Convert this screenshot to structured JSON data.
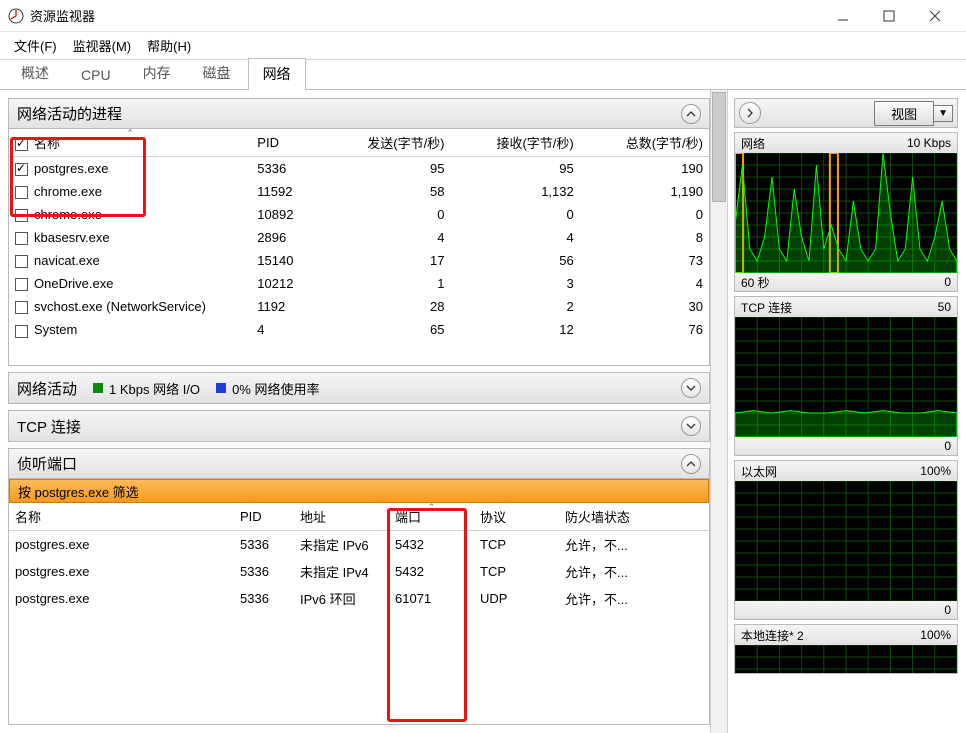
{
  "window": {
    "title": "资源监视器"
  },
  "menu": {
    "file": "文件(F)",
    "monitor": "监视器(M)",
    "help": "帮助(H)"
  },
  "tabs": {
    "t0": "概述",
    "t1": "CPU",
    "t2": "内存",
    "t3": "磁盘",
    "t4": "网络"
  },
  "panels": {
    "processes": {
      "title": "网络活动的进程",
      "cols": {
        "name": "名称",
        "pid": "PID",
        "send": "发送(字节/秒)",
        "recv": "接收(字节/秒)",
        "total": "总数(字节/秒)"
      },
      "rows": [
        {
          "checked": true,
          "name": "postgres.exe",
          "pid": "5336",
          "send": "95",
          "recv": "95",
          "total": "190"
        },
        {
          "checked": false,
          "name": "chrome.exe",
          "pid": "11592",
          "send": "58",
          "recv": "1,132",
          "total": "1,190"
        },
        {
          "checked": false,
          "name": "chrome.exe",
          "pid": "10892",
          "send": "0",
          "recv": "0",
          "total": "0"
        },
        {
          "checked": false,
          "name": "kbasesrv.exe",
          "pid": "2896",
          "send": "4",
          "recv": "4",
          "total": "8"
        },
        {
          "checked": false,
          "name": "navicat.exe",
          "pid": "15140",
          "send": "17",
          "recv": "56",
          "total": "73"
        },
        {
          "checked": false,
          "name": "OneDrive.exe",
          "pid": "10212",
          "send": "1",
          "recv": "3",
          "total": "4"
        },
        {
          "checked": false,
          "name": "svchost.exe (NetworkService)",
          "pid": "1192",
          "send": "28",
          "recv": "2",
          "total": "30"
        },
        {
          "checked": false,
          "name": "System",
          "pid": "4",
          "send": "65",
          "recv": "12",
          "total": "76"
        }
      ]
    },
    "activity": {
      "title": "网络活动",
      "legend1": "1 Kbps 网络 I/O",
      "legend2": "0% 网络使用率",
      "color1": "#0a8a0a",
      "color2": "#1e3fd6"
    },
    "tcp": {
      "title": "TCP 连接"
    },
    "listen": {
      "title": "侦听端口",
      "filter": "按 postgres.exe 筛选",
      "cols": {
        "name": "名称",
        "pid": "PID",
        "addr": "地址",
        "port": "端口",
        "proto": "协议",
        "fw": "防火墙状态"
      },
      "rows": [
        {
          "name": "postgres.exe",
          "pid": "5336",
          "addr": "未指定 IPv6",
          "port": "5432",
          "proto": "TCP",
          "fw": "允许，不..."
        },
        {
          "name": "postgres.exe",
          "pid": "5336",
          "addr": "未指定 IPv4",
          "port": "5432",
          "proto": "TCP",
          "fw": "允许，不..."
        },
        {
          "name": "postgres.exe",
          "pid": "5336",
          "addr": "IPv6 环回",
          "port": "61071",
          "proto": "UDP",
          "fw": "允许，不..."
        }
      ]
    }
  },
  "rightbar": {
    "view_button": "视图",
    "charts": {
      "net": {
        "title": "网络",
        "right": "10 Kbps",
        "footL": "60 秒",
        "footR": "0"
      },
      "tcp": {
        "title": "TCP 连接",
        "right": "50",
        "footR": "0"
      },
      "eth": {
        "title": "以太网",
        "right": "100%",
        "footR": "0"
      },
      "lan": {
        "title": "本地连接* 2",
        "right": "100%"
      }
    }
  },
  "chart_data": [
    {
      "type": "line",
      "title": "网络",
      "ylabel": "Kbps",
      "ylim": [
        0,
        10
      ],
      "xlabel": "秒",
      "xlim": [
        60,
        0
      ],
      "series": [
        {
          "name": "network",
          "color": "#00ff00",
          "x": [
            60,
            58,
            56,
            54,
            52,
            50,
            48,
            46,
            44,
            42,
            40,
            38,
            36,
            34,
            32,
            30,
            28,
            26,
            24,
            22,
            20,
            18,
            16,
            14,
            12,
            10,
            8,
            6,
            4,
            2,
            0
          ],
          "values": [
            4,
            9,
            2,
            1,
            3,
            8,
            2,
            1,
            7,
            3,
            1,
            9,
            2,
            4,
            2,
            1,
            6,
            2,
            1,
            2,
            10,
            5,
            1,
            2,
            8,
            2,
            1,
            3,
            6,
            2,
            1
          ]
        }
      ],
      "highlight_bands_x": [
        [
          60,
          58
        ],
        [
          34,
          32
        ]
      ],
      "highlight_color": "#ffa000"
    },
    {
      "type": "line",
      "title": "TCP 连接",
      "ylim": [
        0,
        50
      ],
      "xlim": [
        60,
        0
      ],
      "series": [
        {
          "name": "tcp",
          "color": "#00ff00",
          "x": [
            60,
            55,
            50,
            45,
            40,
            35,
            30,
            25,
            20,
            15,
            10,
            5,
            0
          ],
          "values": [
            10,
            11,
            10,
            11,
            10,
            10,
            11,
            10,
            11,
            10,
            10,
            11,
            10
          ]
        }
      ]
    },
    {
      "type": "line",
      "title": "以太网",
      "ylim": [
        0,
        100
      ],
      "yunit": "%",
      "xlim": [
        60,
        0
      ],
      "series": [
        {
          "name": "eth",
          "color": "#00ff00",
          "x": [
            60,
            0
          ],
          "values": [
            0,
            0
          ]
        }
      ]
    },
    {
      "type": "line",
      "title": "本地连接* 2",
      "ylim": [
        0,
        100
      ],
      "yunit": "%",
      "xlim": [
        60,
        0
      ],
      "series": [
        {
          "name": "lan",
          "color": "#00ff00",
          "x": [
            60,
            0
          ],
          "values": [
            0,
            0
          ]
        }
      ]
    }
  ]
}
